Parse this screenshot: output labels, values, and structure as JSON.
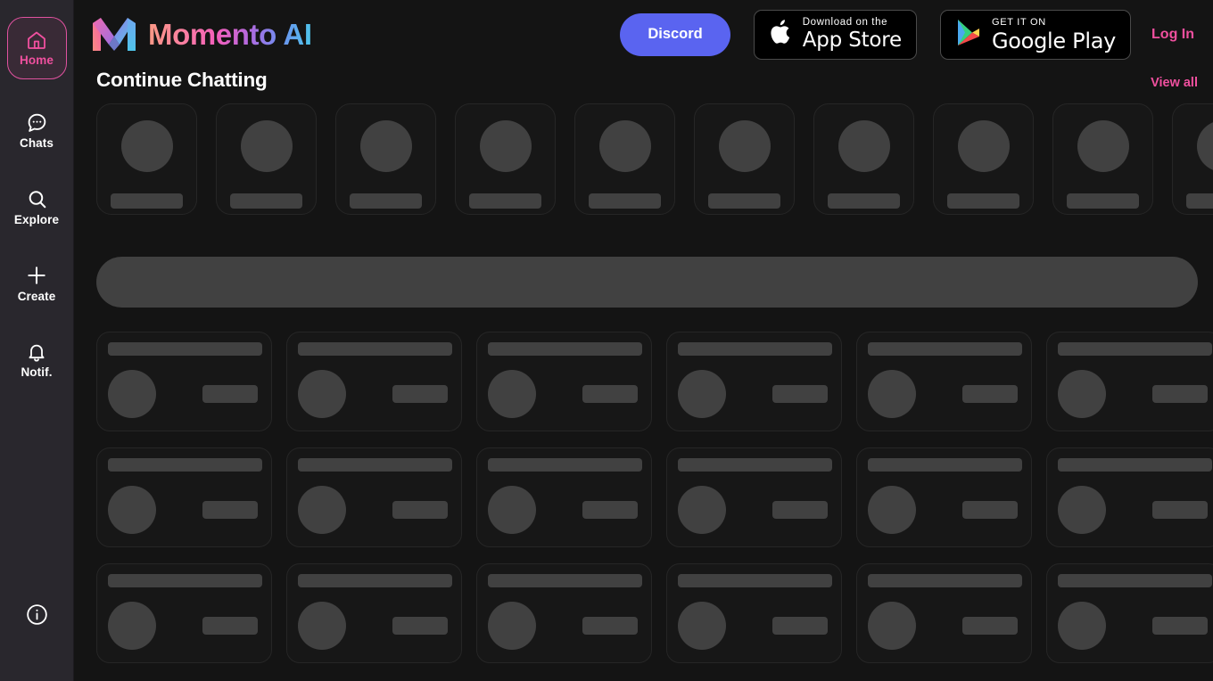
{
  "sidebar": {
    "items": [
      {
        "label": "Home",
        "icon": "home-icon",
        "active": true
      },
      {
        "label": "Chats",
        "icon": "chat-bubble-icon",
        "active": false
      },
      {
        "label": "Explore",
        "icon": "search-icon",
        "active": false
      },
      {
        "label": "Create",
        "icon": "plus-icon",
        "active": false
      },
      {
        "label": "Notif.",
        "icon": "bell-icon",
        "active": false
      }
    ],
    "info_icon": "info-circle-icon",
    "active_color": "#f0509f",
    "background": "#29272d"
  },
  "header": {
    "brand_name": "Momento AI",
    "brand_mark_icon": "momento-m-logo-icon",
    "discord_label": "Discord",
    "app_store": {
      "top_label": "Download on the",
      "bottom_label": "App Store",
      "icon": "apple-logo-icon"
    },
    "google_play": {
      "top_label": "GET IT ON",
      "bottom_label": "Google Play",
      "icon": "google-play-triangle-icon"
    },
    "login_label": "Log In",
    "discord_color": "#5a64f0"
  },
  "main": {
    "section_title": "Continue Chatting",
    "view_all_label": "View all",
    "continue_chatting_card_count": 10,
    "grid_rows": 3,
    "grid_columns": 6,
    "skeleton_color": "#414141",
    "card_background": "#171717",
    "page_background": "#141414",
    "loading_state": true
  }
}
